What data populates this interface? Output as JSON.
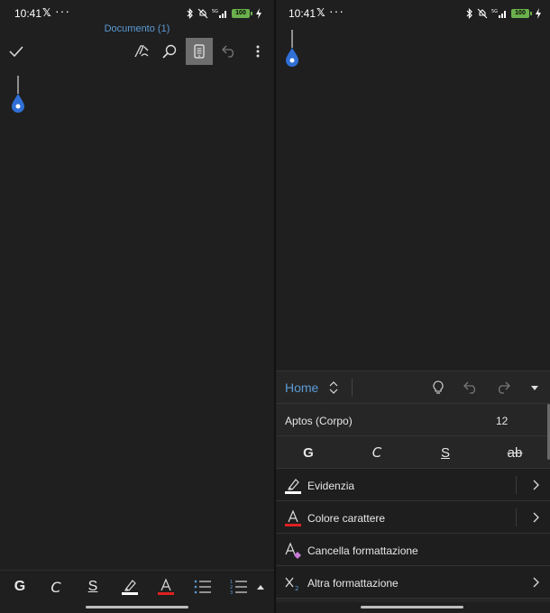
{
  "status": {
    "time": "10:41",
    "x_logo": "𝕏",
    "more": "···",
    "battery": "100"
  },
  "document": {
    "title": "Documento (1)"
  },
  "left_bottom_bar": {
    "bold": "G",
    "italic": "C",
    "underline": "S"
  },
  "ribbon": {
    "tab": "Home",
    "font_name": "Aptos (Corpo)",
    "font_size": "12",
    "format": {
      "bold": "G",
      "italic": "C",
      "underline": "S",
      "strikethrough": "ab"
    },
    "options": [
      {
        "label": "Evidenzia",
        "icon": "highlighter-icon"
      },
      {
        "label": "Colore carattere",
        "icon": "font-color-icon"
      },
      {
        "label": "Cancella formattazione",
        "icon": "clear-formatting-icon"
      },
      {
        "label": "Altra formattazione",
        "icon": "subscript-icon"
      }
    ]
  },
  "colors": {
    "accent": "#5b9bd5",
    "font_color_bar": "#e02020",
    "highlight_bar": "#ffffff",
    "battery": "#6ab04c"
  }
}
